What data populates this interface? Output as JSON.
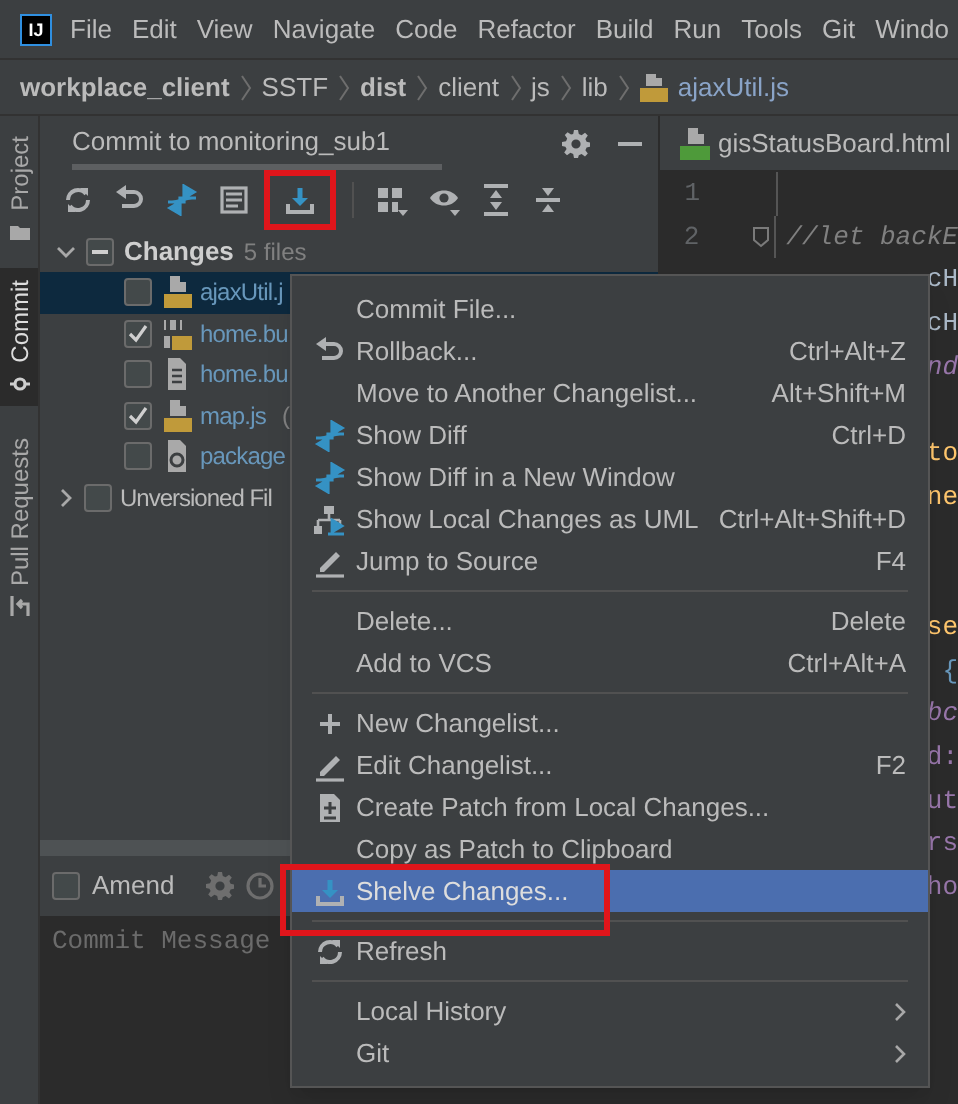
{
  "logo": {
    "text": "IJ"
  },
  "menu_bar": [
    "File",
    "Edit",
    "View",
    "Navigate",
    "Code",
    "Refactor",
    "Build",
    "Run",
    "Tools",
    "Git",
    "Windo"
  ],
  "breadcrumb": [
    {
      "label": "workplace_client",
      "bold": true
    },
    {
      "label": "SSTF",
      "bold": false
    },
    {
      "label": "dist",
      "bold": true
    },
    {
      "label": "client",
      "bold": false
    },
    {
      "label": "js",
      "bold": false
    },
    {
      "label": "lib",
      "bold": false
    },
    {
      "label": "ajaxUtil.js",
      "bold": false,
      "kind": "file"
    }
  ],
  "tool_strip": [
    {
      "label": "Project",
      "selected": false
    },
    {
      "label": "Commit",
      "selected": true
    },
    {
      "label": "Pull Requests",
      "selected": false
    }
  ],
  "commit_panel": {
    "title": "Commit to monitoring_sub1",
    "toolbar": [
      [
        {
          "kind": "refresh",
          "highlighted": false
        },
        {
          "kind": "undo",
          "highlighted": false
        },
        {
          "kind": "diff",
          "highlighted": false
        },
        {
          "kind": "doc",
          "highlighted": false
        },
        {
          "kind": "shelve",
          "highlighted": true
        }
      ],
      [
        {
          "kind": "group",
          "highlighted": false
        },
        {
          "kind": "eye",
          "highlighted": false
        },
        {
          "kind": "expand",
          "highlighted": false
        },
        {
          "kind": "collapse",
          "highlighted": false
        }
      ]
    ],
    "changes": {
      "label": "Changes",
      "count": "5 files",
      "expanded": true,
      "partially_checked": true,
      "files": [
        {
          "name": "ajaxUtil.j",
          "kind": "js",
          "checked": false,
          "selected": true
        },
        {
          "name": "home.bu",
          "kind": "binary",
          "checked": true,
          "selected": false
        },
        {
          "name": "home.bu",
          "kind": "text",
          "checked": false,
          "selected": false
        },
        {
          "name": "map.js",
          "path": "(",
          "kind": "js",
          "checked": true,
          "selected": false
        },
        {
          "name": "package",
          "kind": "json",
          "checked": false,
          "selected": false
        }
      ]
    },
    "unversioned": {
      "label": "Unversioned Fil",
      "expanded": false,
      "checked": false
    },
    "amend": {
      "label": "Amend",
      "checked": false
    },
    "message": {
      "placeholder": "Commit Message"
    }
  },
  "editor": {
    "tab": {
      "label": "gisStatusBoard.html"
    },
    "lines": [
      {
        "kind": "numbered",
        "number": "1"
      },
      {
        "kind": "numbered",
        "number": "2",
        "text": "//let backE"
      },
      {
        "kind": "plain",
        "fragment": "cH"
      },
      {
        "kind": "plain",
        "fragment": "cH"
      },
      {
        "kind": "field",
        "fragment": "nd"
      },
      {
        "kind": "blank"
      },
      {
        "kind": "function",
        "fragment": "to"
      },
      {
        "kind": "function",
        "fragment": "ne"
      },
      {
        "kind": "blank"
      },
      {
        "kind": "blank"
      },
      {
        "kind": "function",
        "fragment": "se"
      },
      {
        "kind": "brace",
        "fragment": "{"
      },
      {
        "kind": "field",
        "fragment": "bc"
      },
      {
        "kind": "member",
        "fragment": "d:"
      },
      {
        "kind": "member",
        "fragment": "ut"
      },
      {
        "kind": "member",
        "fragment": "rs"
      },
      {
        "kind": "member",
        "fragment": "ho"
      }
    ]
  },
  "context_menu": {
    "groups": [
      [
        {
          "label": "Commit File...",
          "kind": "plain",
          "selected": false,
          "highlighted": false
        },
        {
          "label": "Rollback...",
          "shortcut": "Ctrl+Alt+Z",
          "kind": "undo",
          "selected": false,
          "highlighted": false
        },
        {
          "label": "Move to Another Changelist...",
          "shortcut": "Alt+Shift+M",
          "kind": "plain",
          "selected": false,
          "highlighted": false
        },
        {
          "label": "Show Diff",
          "shortcut": "Ctrl+D",
          "kind": "diff",
          "selected": false,
          "highlighted": false
        },
        {
          "label": "Show Diff in a New Window",
          "kind": "diff",
          "selected": false,
          "highlighted": false
        },
        {
          "label": "Show Local Changes as UML",
          "shortcut": "Ctrl+Alt+Shift+D",
          "kind": "uml",
          "selected": false,
          "highlighted": false
        },
        {
          "label": "Jump to Source",
          "shortcut": "F4",
          "kind": "pencil",
          "selected": false,
          "highlighted": false
        }
      ],
      [
        {
          "label": "Delete...",
          "shortcut": "Delete",
          "kind": "plain",
          "selected": false,
          "highlighted": false
        },
        {
          "label": "Add to VCS",
          "shortcut": "Ctrl+Alt+A",
          "kind": "plain",
          "selected": false,
          "highlighted": false
        }
      ],
      [
        {
          "label": "New Changelist...",
          "kind": "plus",
          "selected": false,
          "highlighted": false
        },
        {
          "label": "Edit Changelist...",
          "shortcut": "F2",
          "kind": "pencil",
          "selected": false,
          "highlighted": false
        },
        {
          "label": "Create Patch from Local Changes...",
          "kind": "patch",
          "selected": false,
          "highlighted": false
        },
        {
          "label": "Copy as Patch to Clipboard",
          "kind": "plain",
          "selected": false,
          "highlighted": false
        },
        {
          "label": "Shelve Changes...",
          "kind": "shelve",
          "selected": true,
          "highlighted": true
        }
      ],
      [
        {
          "label": "Refresh",
          "kind": "refresh",
          "selected": false,
          "highlighted": false
        }
      ],
      [
        {
          "label": "Local History",
          "kind": "plain",
          "submenu": true,
          "selected": false,
          "highlighted": false
        },
        {
          "label": "Git",
          "kind": "plain",
          "submenu": true,
          "selected": false,
          "highlighted": false
        }
      ]
    ]
  }
}
